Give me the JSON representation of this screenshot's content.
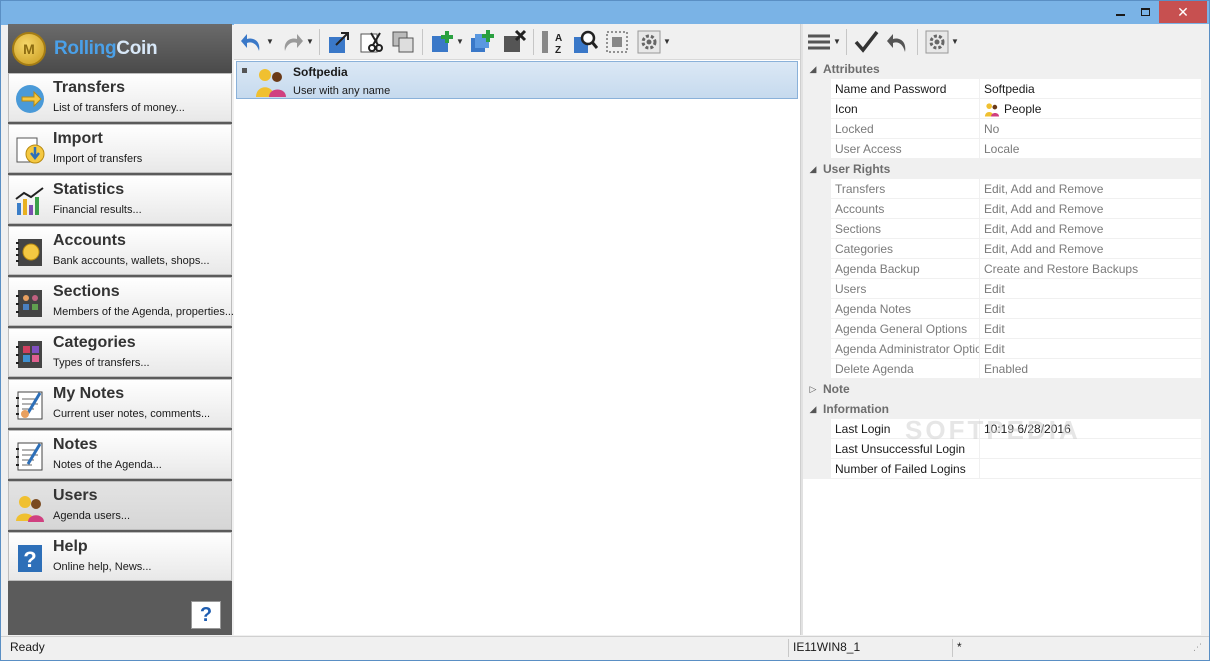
{
  "brand": {
    "name_part1": "Rolling",
    "name_part2": "Coin",
    "coin_glyph": "M"
  },
  "window_controls": {
    "close": "✕"
  },
  "sidebar": {
    "items": [
      {
        "title": "Transfers",
        "subtitle": "List of transfers of money...",
        "icon": "transfers-icon"
      },
      {
        "title": "Import",
        "subtitle": "Import of transfers",
        "icon": "import-icon"
      },
      {
        "title": "Statistics",
        "subtitle": "Financial results...",
        "icon": "statistics-icon"
      },
      {
        "title": "Accounts",
        "subtitle": "Bank accounts, wallets, shops...",
        "icon": "accounts-icon"
      },
      {
        "title": "Sections",
        "subtitle": "Members of the Agenda, properties...",
        "icon": "sections-icon"
      },
      {
        "title": "Categories",
        "subtitle": "Types of transfers...",
        "icon": "categories-icon"
      },
      {
        "title": "My Notes",
        "subtitle": "Current user notes, comments...",
        "icon": "my-notes-icon"
      },
      {
        "title": "Notes",
        "subtitle": "Notes of the Agenda...",
        "icon": "notes-icon"
      },
      {
        "title": "Users",
        "subtitle": "Agenda users...",
        "icon": "users-icon",
        "active": true
      },
      {
        "title": "Help",
        "subtitle": "Online help, News...",
        "icon": "help-icon"
      }
    ],
    "help_button": "?"
  },
  "users_list": [
    {
      "name": "Softpedia",
      "description": "User with any name"
    }
  ],
  "properties": {
    "categories": [
      {
        "name": "Attributes",
        "expanded": true,
        "rows": [
          {
            "name": "Name and Password",
            "value": "Softpedia",
            "editable": true
          },
          {
            "name": "Icon",
            "value": "People",
            "editable": true
          },
          {
            "name": "Locked",
            "value": "No"
          },
          {
            "name": "User Access",
            "value": "Locale"
          }
        ]
      },
      {
        "name": "User Rights",
        "expanded": true,
        "rows": [
          {
            "name": "Transfers",
            "value": "Edit, Add and Remove"
          },
          {
            "name": "Accounts",
            "value": "Edit, Add and Remove"
          },
          {
            "name": "Sections",
            "value": "Edit, Add and Remove"
          },
          {
            "name": "Categories",
            "value": "Edit, Add and Remove"
          },
          {
            "name": "Agenda Backup",
            "value": "Create and Restore Backups"
          },
          {
            "name": "Users",
            "value": "Edit"
          },
          {
            "name": "Agenda Notes",
            "value": "Edit"
          },
          {
            "name": "Agenda General Options",
            "value": "Edit"
          },
          {
            "name": "Agenda Administrator Options",
            "value": "Edit"
          },
          {
            "name": "Delete Agenda",
            "value": "Enabled"
          }
        ]
      },
      {
        "name": "Note",
        "expanded": false,
        "rows": []
      },
      {
        "name": "Information",
        "expanded": true,
        "rows": [
          {
            "name": "Last Login",
            "value": "10:19 6/28/2016",
            "editable": true
          },
          {
            "name": "Last Unsuccessful Login",
            "value": "",
            "editable": true
          },
          {
            "name": "Number of Failed Logins",
            "value": "",
            "editable": true
          }
        ]
      }
    ]
  },
  "statusbar": {
    "status": "Ready",
    "computer": "IE11WIN8_1",
    "modified": "*"
  },
  "watermark": "SOFTPEDIA",
  "colors": {
    "selection": "#c6daee",
    "sidebar_bg": "#5b5b5b",
    "brand_blue": "#4aa0e8"
  }
}
